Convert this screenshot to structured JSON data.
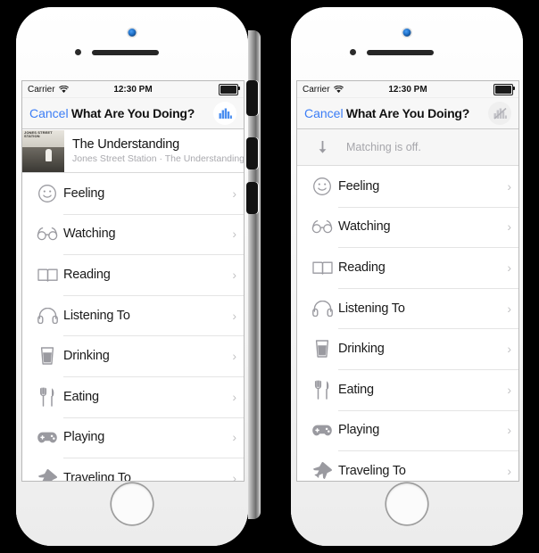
{
  "phones": [
    {
      "id": "left-phone",
      "status_bar": {
        "carrier": "Carrier",
        "wifi_icon": "wifi-icon",
        "time": "12:30 PM",
        "battery_icon": "battery-full-icon"
      },
      "nav_bar": {
        "cancel_label": "Cancel",
        "title": "What Are You Doing?",
        "action_icon": "matching-bars-icon",
        "action_state": "on",
        "accent_color": "#3b7df6"
      },
      "now_playing": {
        "artwork_text": "JONES STREET STATION",
        "title": "The Understanding",
        "subtitle": "Jones Street Station · The Understanding"
      },
      "matching_notice": null,
      "rows": [
        {
          "icon": "smiley-face-icon",
          "label": "Feeling",
          "chevron": "›"
        },
        {
          "icon": "glasses-icon",
          "label": "Watching",
          "chevron": "›"
        },
        {
          "icon": "open-book-icon",
          "label": "Reading",
          "chevron": "›"
        },
        {
          "icon": "headphones-icon",
          "label": "Listening To",
          "chevron": "›"
        },
        {
          "icon": "drink-glass-icon",
          "label": "Drinking",
          "chevron": "›"
        },
        {
          "icon": "fork-knife-icon",
          "label": "Eating",
          "chevron": "›"
        },
        {
          "icon": "gamepad-icon",
          "label": "Playing",
          "chevron": "›"
        },
        {
          "icon": "airplane-icon",
          "label": "Traveling To",
          "chevron": "›"
        }
      ]
    },
    {
      "id": "right-phone",
      "status_bar": {
        "carrier": "Carrier",
        "wifi_icon": "wifi-icon",
        "time": "12:30 PM",
        "battery_icon": "battery-full-icon"
      },
      "nav_bar": {
        "cancel_label": "Cancel",
        "title": "What Are You Doing?",
        "action_icon": "matching-bars-disabled-icon",
        "action_state": "off",
        "accent_color": "#3b7df6"
      },
      "now_playing": null,
      "matching_notice": {
        "icon": "arrow-down-icon",
        "text": "Matching is off."
      },
      "rows": [
        {
          "icon": "smiley-face-icon",
          "label": "Feeling",
          "chevron": "›"
        },
        {
          "icon": "glasses-icon",
          "label": "Watching",
          "chevron": "›"
        },
        {
          "icon": "open-book-icon",
          "label": "Reading",
          "chevron": "›"
        },
        {
          "icon": "headphones-icon",
          "label": "Listening To",
          "chevron": "›"
        },
        {
          "icon": "drink-glass-icon",
          "label": "Drinking",
          "chevron": "›"
        },
        {
          "icon": "fork-knife-icon",
          "label": "Eating",
          "chevron": "›"
        },
        {
          "icon": "gamepad-icon",
          "label": "Playing",
          "chevron": "›"
        },
        {
          "icon": "airplane-icon",
          "label": "Traveling To",
          "chevron": "›"
        }
      ]
    }
  ],
  "hardware": {
    "camera_icon": "front-camera-icon",
    "sensor_icon": "proximity-sensor-icon",
    "speaker_icon": "earpiece-speaker-icon",
    "home_button": "home-button",
    "side_buttons": [
      "mute-switch",
      "volume-up-button",
      "volume-down-button"
    ]
  }
}
